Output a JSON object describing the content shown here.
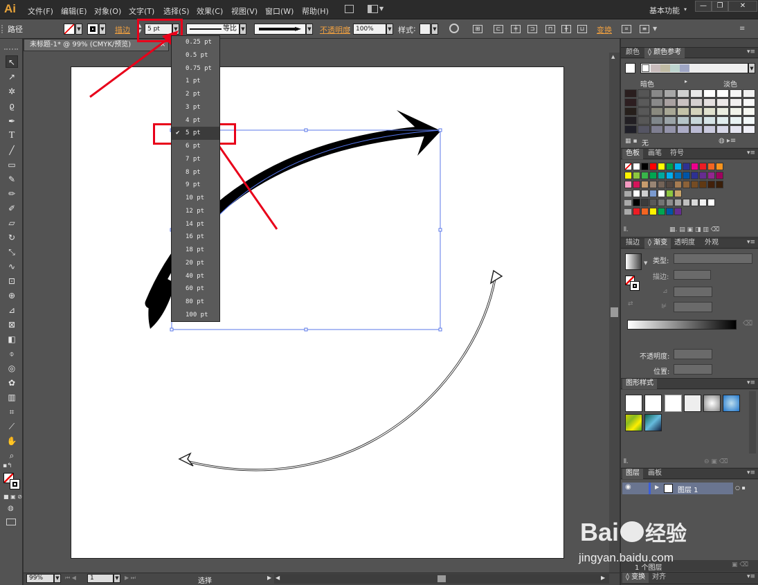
{
  "app": {
    "logo": "Ai",
    "workspace": "基本功能"
  },
  "menu": [
    "文件(F)",
    "编辑(E)",
    "对象(O)",
    "文字(T)",
    "选择(S)",
    "效果(C)",
    "视图(V)",
    "窗口(W)",
    "帮助(H)"
  ],
  "window_controls": {
    "minimize": "—",
    "restore": "❐",
    "close": "✕"
  },
  "control_bar": {
    "object_type": "路径",
    "stroke_link": "描边",
    "stroke_weight": "5 pt",
    "profile_label": "等比",
    "opacity_link": "不透明度",
    "opacity_value": "100%",
    "style_label": "样式",
    "transform_link": "变换"
  },
  "document": {
    "tab_title": "未标题-1* @ 99% (CMYK/预览)",
    "tab_close": "×"
  },
  "stroke_weight_dropdown": {
    "options": [
      "0.25 pt",
      "0.5 pt",
      "0.75 pt",
      "1 pt",
      "2 pt",
      "3 pt",
      "4 pt",
      "5 pt",
      "6 pt",
      "7 pt",
      "8 pt",
      "9 pt",
      "10 pt",
      "12 pt",
      "14 pt",
      "16 pt",
      "18 pt",
      "20 pt",
      "40 pt",
      "60 pt",
      "80 pt",
      "100 pt"
    ],
    "selected": "5 pt",
    "check": "✔"
  },
  "status_bar": {
    "zoom": "99%",
    "page": "1",
    "status": "选择"
  },
  "panels": {
    "color": {
      "tabs": [
        "颜色",
        "颜色参考"
      ],
      "darker": "暗色",
      "lighter": "淡色",
      "none_label": "无"
    },
    "swatches": {
      "tabs": [
        "色板",
        "画笔",
        "符号"
      ]
    },
    "gradient": {
      "tabs": [
        "描边",
        "渐变",
        "透明度",
        "外观"
      ],
      "type_label": "类型:",
      "stroke_label": "描边:",
      "opacity_label": "不透明度:",
      "location_label": "位置:"
    },
    "graphic_styles": {
      "tabs": [
        "图形样式"
      ]
    },
    "layers": {
      "tabs": [
        "图层",
        "画板"
      ],
      "layer_name": "图层 1",
      "footer": "1 个图层"
    },
    "transform": {
      "tabs": [
        "变换",
        "对齐"
      ]
    }
  },
  "watermark": {
    "brand": "Bai",
    "brand_cn": "经验",
    "url": "jingyan.baidu.com"
  },
  "colors": {
    "accent_red": "#e8001a",
    "orange_link": "#f0a040",
    "selection_blue": "#4a6fe8",
    "panel_bg": "#535353"
  },
  "color_guide_rows": [
    [
      "#2a1e1e",
      "#555",
      "#888",
      "#a7a7a7",
      "#d0d0d0",
      "#e8e8e8",
      "#fff",
      "#fff",
      "#f5f5f5",
      "#f0f0f0"
    ],
    [
      "#2d1e20",
      "#5a5a5a",
      "#8a8a8a",
      "#a9a1a1",
      "#c9c1c1",
      "#d5d0d0",
      "#e5e0e0",
      "#ece8e8",
      "#f2f0f0",
      "#f8f8f8"
    ],
    [
      "#261f1b",
      "#585858",
      "#8a8a7f",
      "#a8a795",
      "#c3c2a8",
      "#d4d3bc",
      "#e1e2cf",
      "#ebede1",
      "#f1f3ea",
      "#f7f8f2"
    ],
    [
      "#221f23",
      "#575757",
      "#80878b",
      "#9ba4a8",
      "#b6c5c9",
      "#c8d7da",
      "#d6e4e7",
      "#e1edef",
      "#e9f3f4",
      "#f2f8f9"
    ],
    [
      "#1f1f28",
      "#555563",
      "#7f7f91",
      "#9494aa",
      "#acacc6",
      "#bbbbd4",
      "#cacade",
      "#d7d7e8",
      "#e4e4f0",
      "#eeeef6"
    ]
  ],
  "swatch_rows": [
    [
      "#ffffff",
      "#ffffff",
      "#000000",
      "#ff0000",
      "#ffff00",
      "#00a14b",
      "#00aeef",
      "#2e3192",
      "#ec008c",
      "#ed1c24",
      "#f26522",
      "#f7941d"
    ],
    [
      "#fff200",
      "#8dc63f",
      "#39b54a",
      "#00a651",
      "#00a99d",
      "#00aeef",
      "#0072bc",
      "#0054a6",
      "#2e3192",
      "#662d91",
      "#92278f",
      "#9e005d"
    ],
    [
      "#f49ac1",
      "#d4145a",
      "#c69c6d",
      "#998675",
      "#736357",
      "#534741",
      "#a67c52",
      "#8c6239",
      "#754c24",
      "#603913",
      "#42210b",
      "#3a1f0a"
    ],
    [
      "#fff",
      "#cfcfcf",
      "#7a9ad0",
      "#fff",
      "#8dc63f",
      "#c9a56a"
    ],
    [
      "#000000",
      "#3b3b3b",
      "#595959",
      "#737373",
      "#8c8c8c",
      "#a6a6a6",
      "#bfbfbf",
      "#d9d9d9",
      "#f2f2f2",
      "#ffffff"
    ],
    [
      "#ed1c24",
      "#f26522",
      "#fff200",
      "#00a651",
      "#0054a6",
      "#662d91"
    ]
  ]
}
